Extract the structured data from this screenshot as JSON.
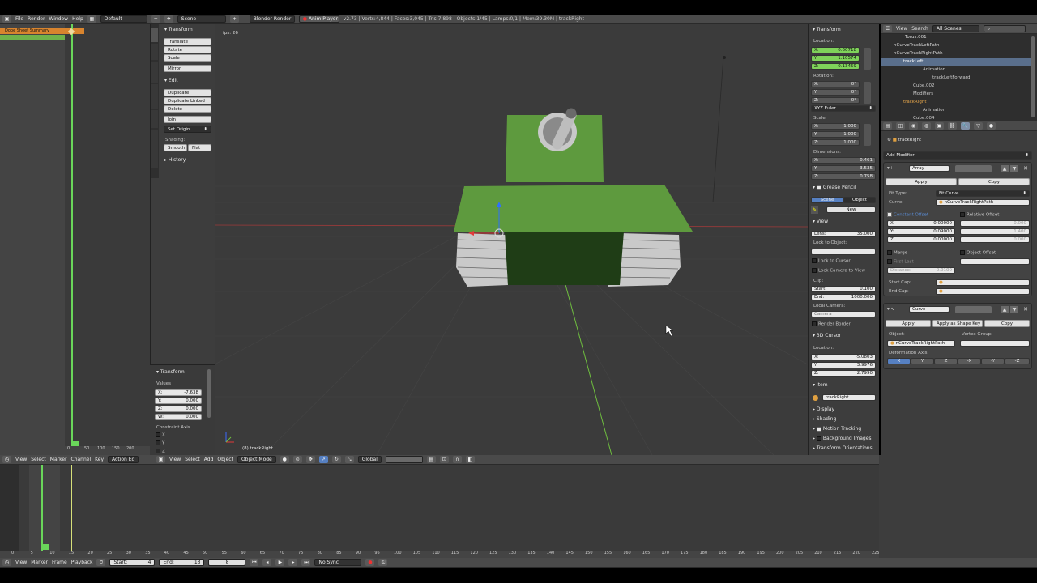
{
  "info_header": {
    "menus": [
      "File",
      "Render",
      "Window",
      "Help"
    ],
    "layout": "Default",
    "scene": "Scene",
    "engine": "Blender Render",
    "anim_player": "Anim Player",
    "stats": "v2.73 | Verts:4,844 | Faces:3,045 | Tris:7,898 | Objects:1/45 | Lamps:0/1 | Mem:39.30M | trackRight"
  },
  "dopesheet": {
    "summary": "Dope Sheet Summary",
    "ticks": [
      "0",
      "50",
      "100",
      "150",
      "200"
    ],
    "header_menus": [
      "View",
      "Select",
      "Marker",
      "Channel",
      "Key"
    ],
    "mode": "Action Ed"
  },
  "toolshelf": {
    "tabs": [
      "Tools",
      "Create",
      "Relations",
      "Animation",
      "Physics",
      "Grease Pencil"
    ],
    "transform_title": "Transform",
    "transform_buttons": [
      "Translate",
      "Rotate",
      "Scale"
    ],
    "mirror": "Mirror",
    "edit_title": "Edit",
    "edit_buttons": [
      "Duplicate",
      "Duplicate Linked",
      "Delete"
    ],
    "join": "Join",
    "set_origin": "Set Origin",
    "shading_label": "Shading:",
    "smooth": "Smooth",
    "flat": "Flat",
    "history_title": "History"
  },
  "operator_panel": {
    "title": "Transform",
    "values_label": "Values",
    "x": "X:",
    "x_val": "-7.638",
    "y": "Y:",
    "y_val": "0.000",
    "z": "Z:",
    "z_val": "0.000",
    "w": "W:",
    "w_val": "0.000",
    "axis_label": "Constraint Axis",
    "axes": [
      "X",
      "Y",
      "Z"
    ]
  },
  "viewport": {
    "fps": "fps: 26",
    "object_label": "(8) trackRight",
    "header_menus": [
      "View",
      "Select",
      "Add",
      "Object"
    ],
    "mode": "Object Mode",
    "orientation": "Global",
    "colors": {
      "bg": "#3b3b3b",
      "tank_green": "#5e9a3e",
      "tank_dark": "#1f3d16"
    }
  },
  "properties_n": {
    "transform": "Transform",
    "location": "Location:",
    "loc": [
      "X:",
      "0.60718",
      "Y:",
      "1.10574",
      "Z:",
      "0.13459"
    ],
    "rotation": "Rotation:",
    "rot": [
      "X:",
      "0°",
      "Y:",
      "0°",
      "Z:",
      "0°"
    ],
    "euler": "XYZ Euler",
    "scale": "Scale:",
    "scl": [
      "X:",
      "1.000",
      "Y:",
      "1.000",
      "Z:",
      "1.000"
    ],
    "dimensions": "Dimensions:",
    "dim": [
      "X:",
      "0.461",
      "Y:",
      "3.535",
      "Z:",
      "0.758"
    ],
    "grease_pencil": "Grease Pencil",
    "gp_scene": "Scene",
    "gp_object": "Object",
    "gp_new": "New",
    "view": "View",
    "lens": "Lens:",
    "lens_val": "35.000",
    "lock_to_object": "Lock to Object:",
    "lock_to_cursor": "Lock to Cursor",
    "lock_camera": "Lock Camera to View",
    "clip": "Clip:",
    "clip_start": "Start:",
    "clip_start_val": "0.100",
    "clip_end": "End:",
    "clip_end_val": "1000.000",
    "local_camera": "Local Camera:",
    "camera": "Camera",
    "render_border": "Render Border",
    "cursor_3d": "3D Cursor",
    "cur_location": "Location:",
    "cur": [
      "X:",
      "-5.0803",
      "Y:",
      "3.9976",
      "Z:",
      "2.7990"
    ],
    "item": "Item",
    "item_name": "trackRight",
    "display": "Display",
    "shading": "Shading",
    "motion_tracking": "Motion Tracking",
    "background_images": "Background Images",
    "transform_orientations": "Transform Orientations"
  },
  "outliner": {
    "header_menus": [
      "View",
      "Search"
    ],
    "filter": "All Scenes",
    "items": [
      "Torus.001",
      "nCurveTrackLeftPath",
      "nCurveTrackRightPath",
      "trackLeft",
      "Animation",
      "trackLeftForward",
      "Cube.002",
      "Modifiers",
      "trackRight",
      "Animation",
      "Cube.004"
    ]
  },
  "modifiers": {
    "object_name": "trackRight",
    "add_modifier": "Add Modifier",
    "array_name": "Array",
    "apply": "Apply",
    "copy": "Copy",
    "fit_type_label": "Fit Type:",
    "fit_type": "Fit Curve",
    "curve_label": "Curve:",
    "curve_val": "nCurveTrackRightPath",
    "constant_offset": "Constant Offset",
    "relative_offset": "Relative Offset",
    "const": [
      "X:",
      "0.00000",
      "Y:",
      "0.09000",
      "Z:",
      "0.00000"
    ],
    "rel": [
      "0.000",
      "1.400",
      "0.000"
    ],
    "merge": "Merge",
    "object_offset": "Object Offset",
    "first_last": "First Last",
    "distance": "Distance:",
    "distance_val": "0.0100",
    "start_cap": "Start Cap:",
    "end_cap": "End Cap:",
    "curve_mod_name": "Curve",
    "apply2": "Apply",
    "apply_shape": "Apply as Shape Key",
    "copy2": "Copy",
    "object_label": "Object:",
    "object_val": "nCurveTrackRightPath",
    "vertex_group": "Vertex Group:",
    "deform_axis": "Deformation Axis:",
    "axes": [
      "X",
      "Y",
      "Z",
      "-X",
      "-Y",
      "-Z"
    ]
  },
  "timeline": {
    "ticks": [
      "0",
      "5",
      "10",
      "15",
      "20",
      "25",
      "30",
      "35",
      "40",
      "45",
      "50",
      "55",
      "60",
      "65",
      "70",
      "75",
      "80",
      "85",
      "90",
      "95",
      "100",
      "105",
      "110",
      "115",
      "120",
      "125",
      "130",
      "135",
      "140",
      "145",
      "150",
      "155",
      "160",
      "165",
      "170",
      "175",
      "180",
      "185",
      "190",
      "195",
      "200",
      "205",
      "210",
      "215",
      "220",
      "225"
    ],
    "header_menus": [
      "View",
      "Marker",
      "Frame",
      "Playback"
    ],
    "start_label": "Start:",
    "start_val": "4",
    "end_label": "End:",
    "end_val": "13",
    "frame_val": "8",
    "sync": "No Sync"
  }
}
